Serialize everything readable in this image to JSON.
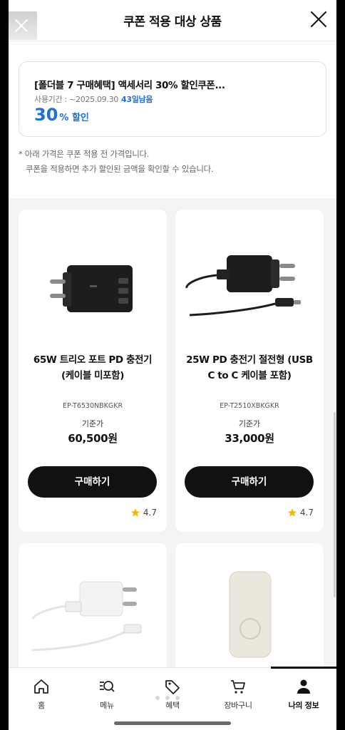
{
  "header": {
    "title": "쿠폰 적용 대상 상품"
  },
  "coupon": {
    "title": "[폴더블 7 구매혜택] 액세서리 30% 할인쿠폰...",
    "period": "사용기간 : ~2025.09.30",
    "days_left": "43일남음",
    "discount_value": "30",
    "discount_unit": "% 할인"
  },
  "notice": {
    "line1": "* 아래 가격은 쿠폰 적용 전 가격입니다.",
    "line2": "쿠폰을 적용하면 추가 할인된 금액을 확인할 수 있습니다."
  },
  "products": [
    {
      "name_line1": "65W 트리오 포트 PD 충전기",
      "name_line2": "(케이블 미포함)",
      "code": "EP-T6530NBKGKR",
      "price_label": "기준가",
      "price": "60,500원",
      "buy_label": "구매하기",
      "rating": "4.7"
    },
    {
      "name_line1": "25W PD 충전기 절전형 (USB",
      "name_line2": "C to C 케이블 포함)",
      "code": "EP-T2510XBKGKR",
      "price_label": "기준가",
      "price": "33,000원",
      "buy_label": "구매하기",
      "rating": "4.7"
    }
  ],
  "tabbar": [
    {
      "label": "홈",
      "icon": "home-icon"
    },
    {
      "label": "메뉴",
      "icon": "menu-search-icon"
    },
    {
      "label": "혜택",
      "icon": "tag-icon"
    },
    {
      "label": "장바구니",
      "icon": "cart-icon"
    },
    {
      "label": "나의 정보",
      "icon": "person-icon",
      "active": true
    }
  ],
  "colors": {
    "accent": "#1f6fd6",
    "button": "#111111",
    "star": "#f5b800"
  }
}
